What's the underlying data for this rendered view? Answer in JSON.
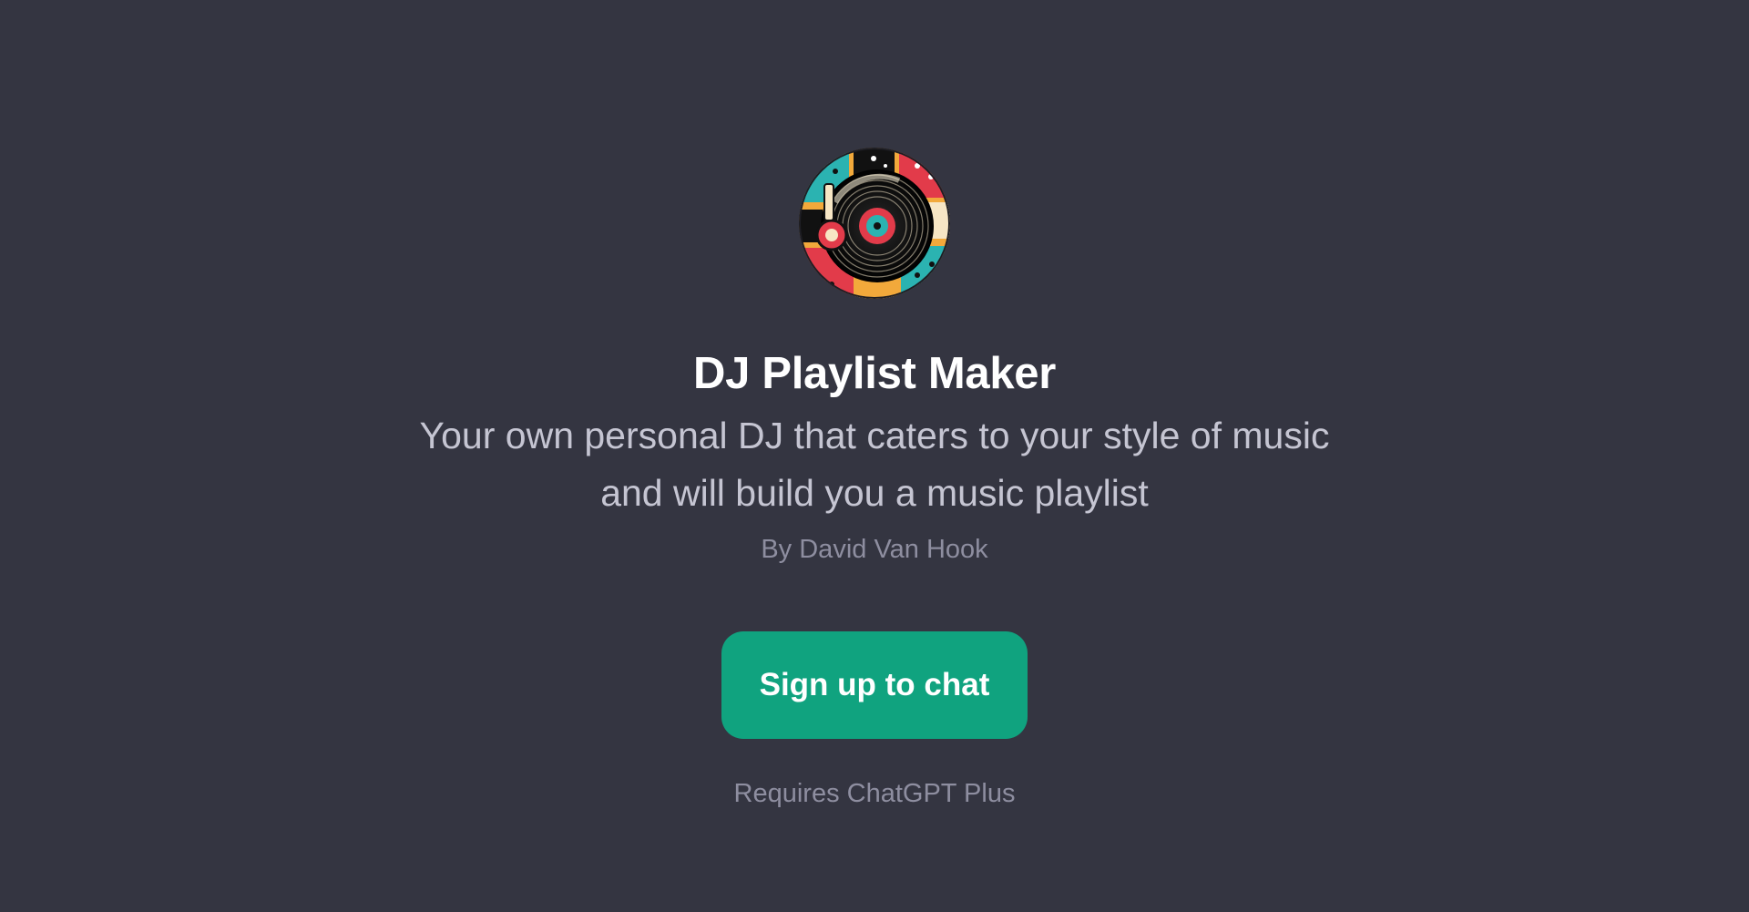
{
  "gpt": {
    "title": "DJ Playlist Maker",
    "description": "Your own personal DJ that caters to your style of music and will build you a music playlist",
    "author": "By David Van Hook",
    "avatar_icon": "vinyl-record-icon"
  },
  "actions": {
    "signup_label": "Sign up to chat",
    "requirement": "Requires ChatGPT Plus"
  },
  "colors": {
    "background": "#343541",
    "title": "#ffffff",
    "description": "#c5c5d2",
    "muted": "#8e8ea0",
    "accent": "#10a37f"
  }
}
